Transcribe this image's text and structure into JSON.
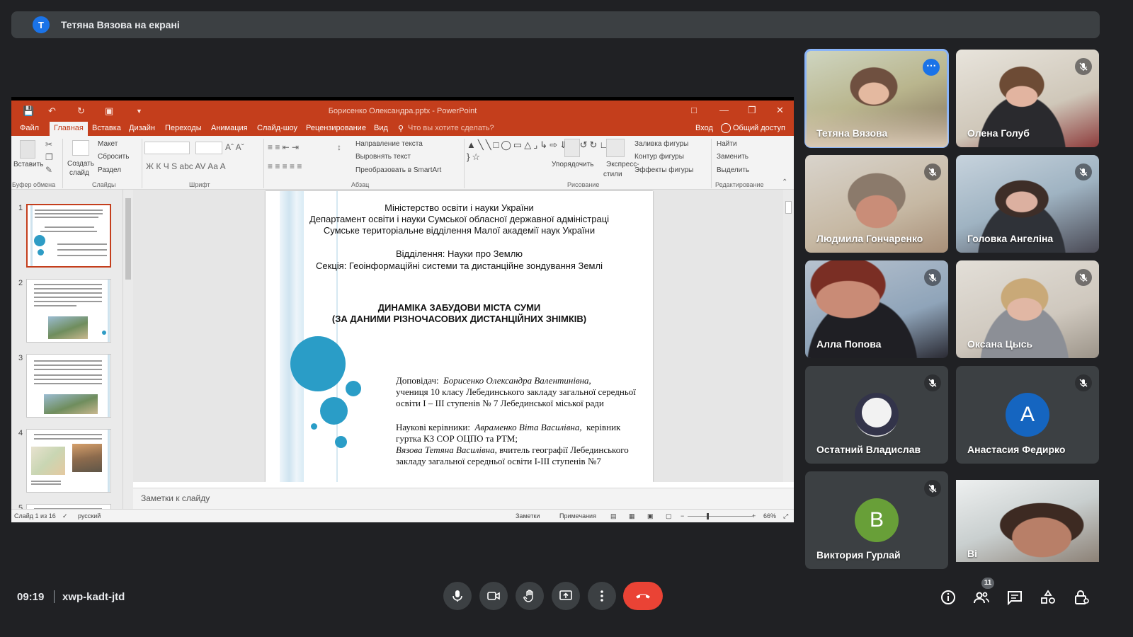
{
  "banner": {
    "initial": "Т",
    "text": "Тетяна Вязова на екрані"
  },
  "powerpoint": {
    "title": "Борисенко Олександра.pptx - PowerPoint",
    "tabs": [
      "Файл",
      "Главная",
      "Вставка",
      "Дизайн",
      "Переходы",
      "Анимация",
      "Слайд-шоу",
      "Рецензирование",
      "Вид"
    ],
    "active_tab": "Главная",
    "search_hint": "Что вы хотите сделать?",
    "signin": "Вход",
    "share": "Общий доступ",
    "ribbon": {
      "paste": "Вставить",
      "create_slide": "Создать",
      "create_slide2": "слайд",
      "layout": "Макет",
      "reset": "Сбросить",
      "section": "Раздел",
      "text_direction": "Направление текста",
      "align_text": "Выровнять текст",
      "smartart": "Преобразовать в SmartArt",
      "arrange": "Упорядочить",
      "quick_styles": "Экспресс-",
      "quick_styles2": "стили",
      "shape_fill": "Заливка фигуры",
      "shape_outline": "Контур фигуры",
      "shape_effects": "Эффекты фигуры",
      "find": "Найти",
      "replace": "Заменить",
      "select": "Выделить",
      "font_buttons": "Ж  К  Ч  S  abc  AV  Aa  A",
      "groups": {
        "clipboard": "Буфер обмена",
        "slides": "Слайды",
        "font": "Шрифт",
        "paragraph": "Абзац",
        "drawing": "Рисование",
        "editing": "Редактирование"
      }
    },
    "thumb_numbers": [
      "1",
      "2",
      "3",
      "4",
      "5"
    ],
    "slide": {
      "line1": "Міністерство освіти і науки України",
      "line2": "Департамент освіти і науки Сумської обласної державної адміністраці",
      "line3": "Сумське територіальне відділення Малої академії наук України",
      "line4": "Відділення: Науки про Землю",
      "line5": "Секція: Геоінформаційні системи та дистанційне зондування Землі",
      "title1": "ДИНАМІКА ЗАБУДОВИ МІСТА СУМИ",
      "title2": "(ЗА ДАНИМИ РІЗНОЧАСОВИХ ДИСТАНЦІЙНИХ ЗНІМКІВ)",
      "speaker_label": "Доповідач:",
      "speaker_name": "Борисенко Олександра Валентинівна,",
      "speaker_line2": "учениця 10 класу Лебединського закладу загальної середньої",
      "speaker_line3": "освіти І – ІІІ ступенів № 7 Лебединської міської ради",
      "advisors_label": "Наукові керівники:",
      "advisor1": "Авраменко Віта Василівна,",
      "advisor1_role": "керівник",
      "advisor1_line2": "гуртка КЗ СОР ОЦПО та РТМ;",
      "advisor2": "Вязова Тетяна Василівна,",
      "advisor2_role": "вчитель географії Лебединського",
      "advisor2_line2": "закладу загальної середньої освіти І-ІІІ ступенів №7"
    },
    "notes": "Заметки к слайду",
    "status": {
      "slide_count": "Слайд 1 из 16",
      "language": "русский",
      "notes_btn": "Заметки",
      "comments_btn": "Примечания",
      "zoom": "66%"
    }
  },
  "participants": [
    {
      "name": "Тетяна Вязова",
      "speaking": true,
      "muted": false
    },
    {
      "name": "Олена Голуб",
      "muted": true
    },
    {
      "name": "Людмила Гончаренко",
      "muted": true
    },
    {
      "name": "Головка Ангеліна",
      "muted": true
    },
    {
      "name": "Алла Попова",
      "muted": true
    },
    {
      "name": "Оксана Цысь",
      "muted": true
    },
    {
      "name": "Остатний Владислав",
      "muted": true
    },
    {
      "name": "Анастасия Федирко",
      "muted": true,
      "initial": "A",
      "color": "#1565c0"
    },
    {
      "name": "Виктория Гурлай",
      "muted": true,
      "initial": "B",
      "color": "#689f38"
    },
    {
      "name": "Ві"
    }
  ],
  "footer": {
    "time": "09:19",
    "meeting_code": "xwp-kadt-jtd",
    "participant_count": "11",
    "end_call_color": "#ea4335"
  }
}
